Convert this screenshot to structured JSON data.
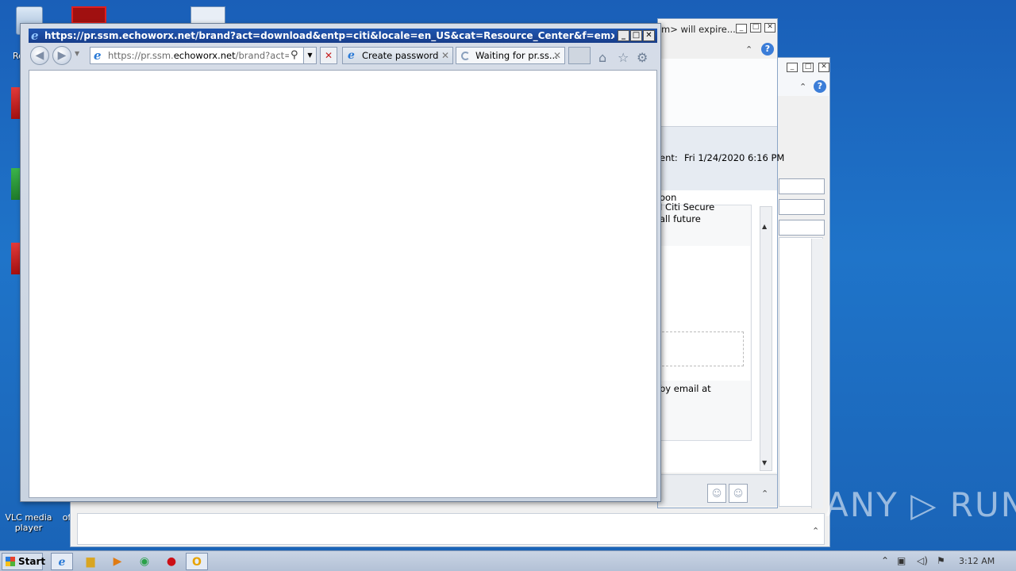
{
  "ie": {
    "title": "https://pr.ssm.echoworx.net/brand?act=download&entp=citi&locale=en_US&cat=Resource_Center&f=emx - Internet Expl...",
    "address_prefix": "https://pr.ssm.",
    "address_domain": "echoworx.net",
    "address_suffix": "/brand?act=down",
    "tabs": [
      {
        "label": "Create password"
      },
      {
        "label": "Waiting for pr.ss..."
      }
    ],
    "tab_close": "✕",
    "minimize": "_",
    "maximize": "□",
    "close": "✕"
  },
  "outlook_back": {
    "title_fragment": "m> will expire...",
    "sent_label": "ent:",
    "sent_value": "Fri 1/24/2020 6:16 PM",
    "body_lines": [
      "oon",
      "I Citi Secure",
      "all future",
      "by email at"
    ]
  },
  "desktop": {
    "icons": [
      {
        "label": "Re"
      },
      {
        "label": "VLC media player"
      },
      {
        "label": "of"
      }
    ]
  },
  "taskbar": {
    "start_label": "Start",
    "clock": "3:12 AM"
  },
  "watermark": {
    "text": "ANY ▷ RUN"
  },
  "colors": {
    "desktop_top": "#1a5fb8",
    "ie_titlebar": "#1f56b1",
    "link_blue": "#2a7ad6"
  }
}
